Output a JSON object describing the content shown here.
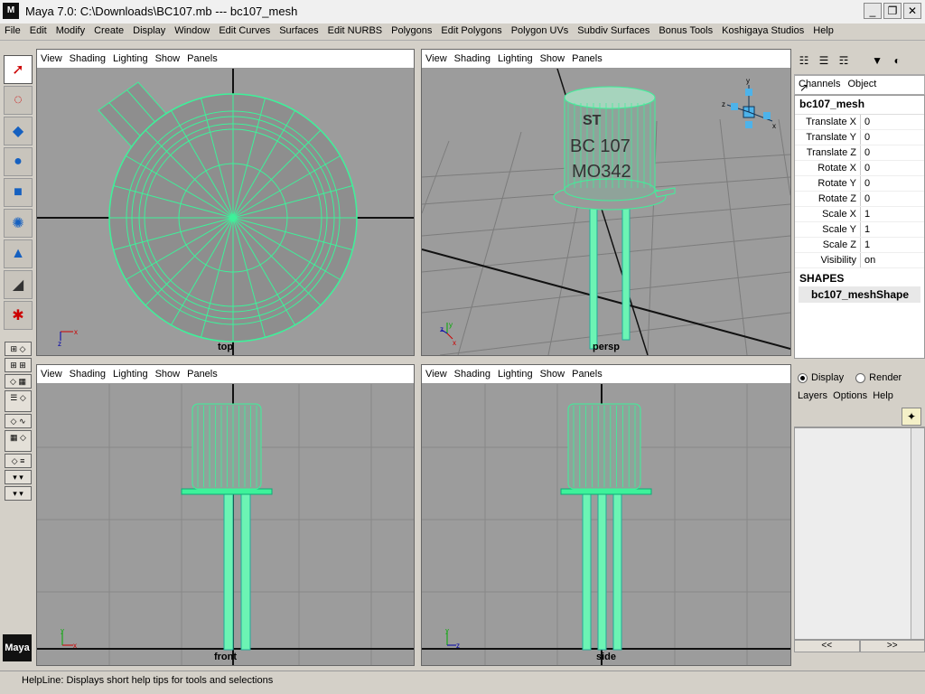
{
  "window": {
    "title": "Maya 7.0: C:\\Downloads\\BC107.mb   ---   bc107_mesh",
    "logo": "M",
    "minimize": "_",
    "restore": "❐",
    "close": "✕"
  },
  "menu": [
    "File",
    "Edit",
    "Modify",
    "Create",
    "Display",
    "Window",
    "Edit Curves",
    "Surfaces",
    "Edit NURBS",
    "Polygons",
    "Edit Polygons",
    "Polygon UVs",
    "Subdiv Surfaces",
    "Bonus Tools",
    "Koshigaya Studios",
    "Help"
  ],
  "viewport_menu": [
    "View",
    "Shading",
    "Lighting",
    "Show",
    "Panels"
  ],
  "viewports": {
    "top": {
      "label": "top"
    },
    "persp": {
      "label": "persp",
      "marking_line1": "BC 107",
      "marking_line2": "MO342"
    },
    "front": {
      "label": "front"
    },
    "side": {
      "label": "side"
    }
  },
  "colors": {
    "wire": "#3df29a",
    "viewport_bg": "#9c9c9c",
    "grid": "#888888"
  },
  "channels": {
    "tabs": [
      "Channels",
      "Object"
    ],
    "object_name": "bc107_mesh",
    "rows": [
      {
        "label": "Translate X",
        "value": "0"
      },
      {
        "label": "Translate Y",
        "value": "0"
      },
      {
        "label": "Translate Z",
        "value": "0"
      },
      {
        "label": "Rotate X",
        "value": "0"
      },
      {
        "label": "Rotate Y",
        "value": "0"
      },
      {
        "label": "Rotate Z",
        "value": "0"
      },
      {
        "label": "Scale X",
        "value": "1"
      },
      {
        "label": "Scale Y",
        "value": "1"
      },
      {
        "label": "Scale Z",
        "value": "1"
      },
      {
        "label": "Visibility",
        "value": "on"
      }
    ],
    "shapes_heading": "SHAPES",
    "shape_name": "bc107_meshShape"
  },
  "layer_editor": {
    "display_label": "Display",
    "render_label": "Render",
    "menu": [
      "Layers",
      "Options",
      "Help"
    ],
    "nav_left": "<<",
    "nav_right": ">>"
  },
  "helpline": "HelpLine: Displays short help tips for tools and selections",
  "maya_logo": "Maya"
}
